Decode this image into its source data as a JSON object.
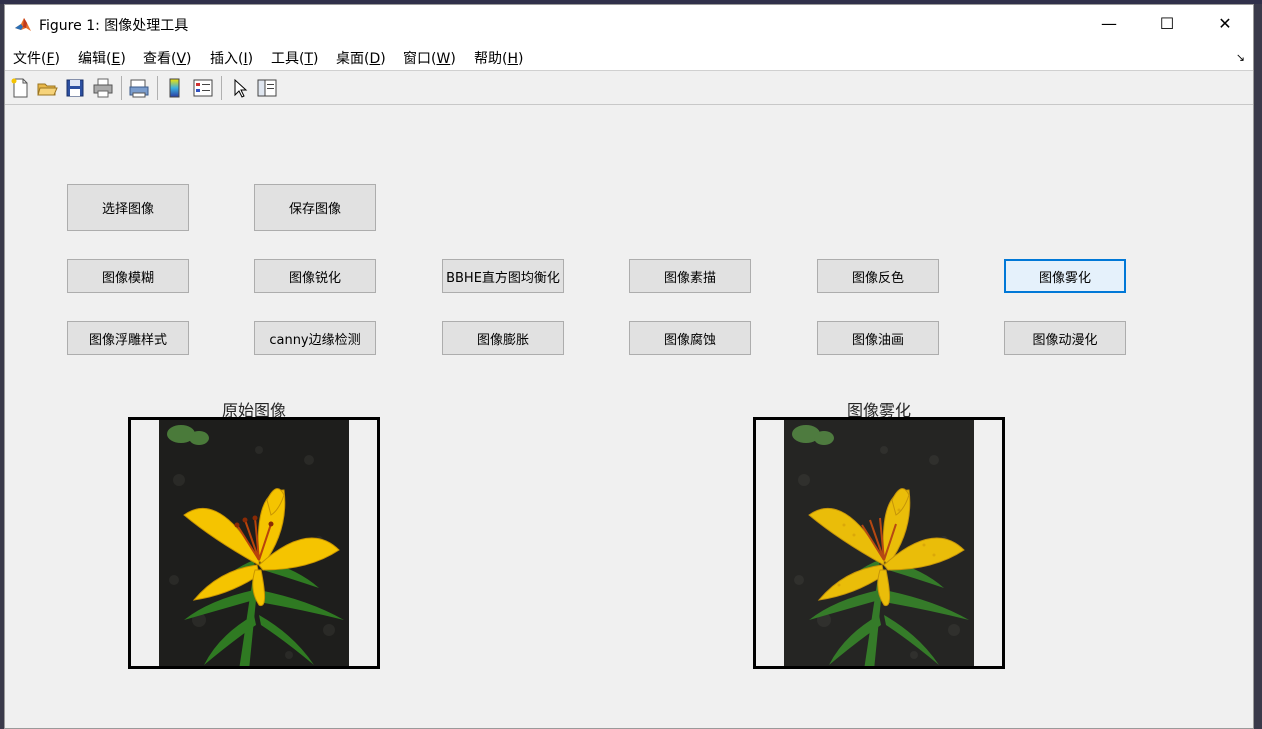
{
  "window": {
    "title": "Figure 1: 图像处理工具",
    "controls": {
      "minimize": "—",
      "maximize": "☐",
      "close": "✕"
    }
  },
  "menubar": {
    "items": [
      {
        "label": "文件(",
        "key": "F",
        "end": ")"
      },
      {
        "label": "编辑(",
        "key": "E",
        "end": ")"
      },
      {
        "label": "查看(",
        "key": "V",
        "end": ")"
      },
      {
        "label": "插入(",
        "key": "I",
        "end": ")"
      },
      {
        "label": "工具(",
        "key": "T",
        "end": ")"
      },
      {
        "label": "桌面(",
        "key": "D",
        "end": ")"
      },
      {
        "label": "窗口(",
        "key": "W",
        "end": ")"
      },
      {
        "label": "帮助(",
        "key": "H",
        "end": ")"
      }
    ],
    "dock_icon": "↘"
  },
  "toolbar": {
    "icons": [
      "new-figure-icon",
      "open-file-icon",
      "save-icon",
      "print-icon",
      "print-preview-icon",
      "colorbar-icon",
      "legend-icon",
      "pointer-icon",
      "property-inspector-icon"
    ]
  },
  "buttons": {
    "select_image": "选择图像",
    "save_image": "保存图像",
    "blur": "图像模糊",
    "sharpen": "图像锐化",
    "bbhe": "BBHE直方图均衡化",
    "sketch": "图像素描",
    "invert": "图像反色",
    "fog": "图像雾化",
    "emboss": "图像浮雕样式",
    "canny": "canny边缘检测",
    "dilate": "图像膨胀",
    "erode": "图像腐蚀",
    "oil": "图像油画",
    "anime": "图像动漫化"
  },
  "active_button": "fog",
  "axes": {
    "original_title": "原始图像",
    "result_title": "图像雾化"
  },
  "colors": {
    "active_border": "#0078d7",
    "flower_yellow": "#f5c400",
    "soil": "#1c1c1c",
    "leaf": "#2f7a22"
  }
}
